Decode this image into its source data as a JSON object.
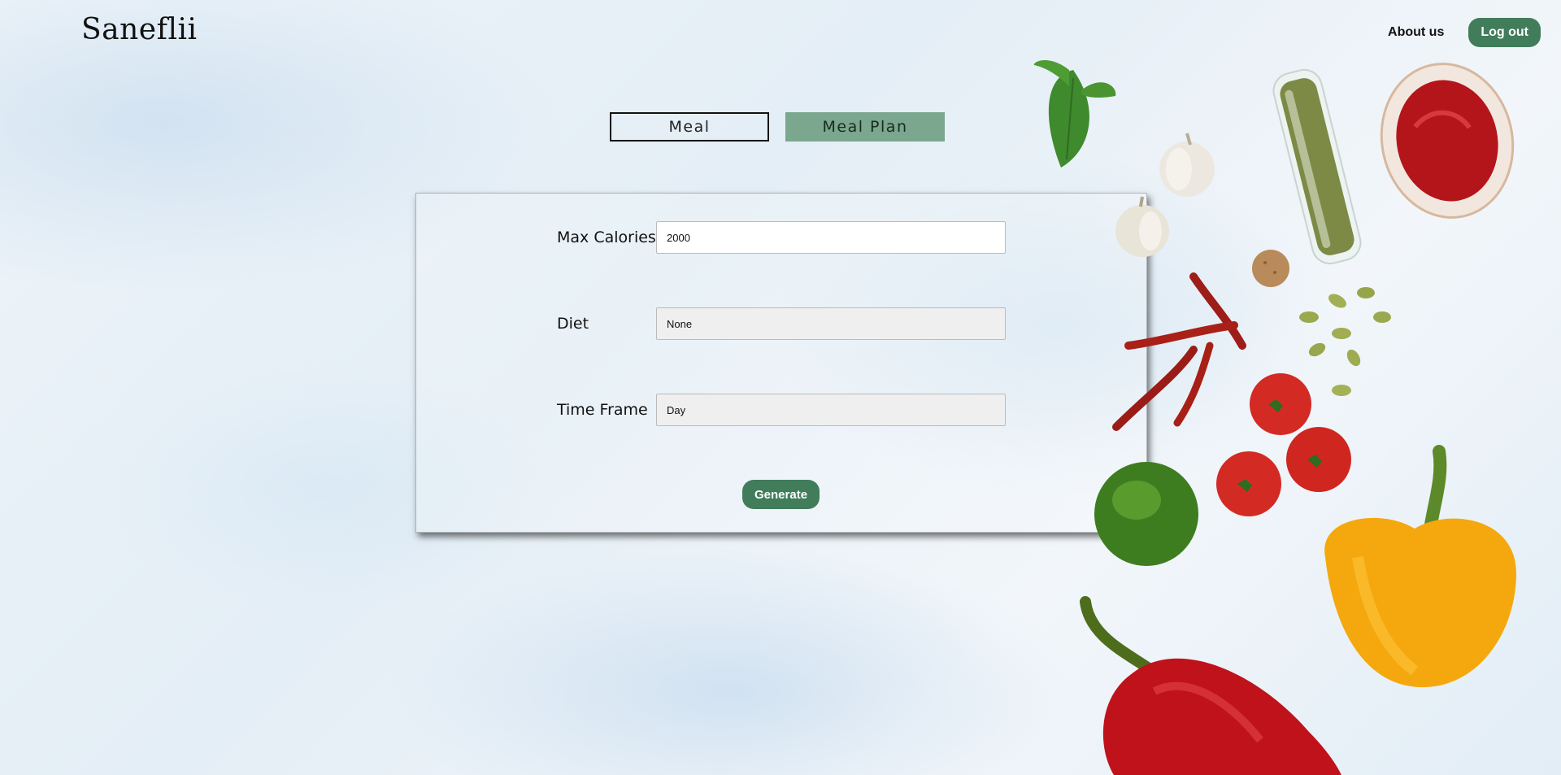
{
  "header": {
    "brand": "Saneflii",
    "about_label": "About us",
    "logout_label": "Log out"
  },
  "tabs": [
    {
      "label": "Meal",
      "active": false
    },
    {
      "label": "Meal Plan",
      "active": true
    }
  ],
  "form": {
    "max_calories_label": "Max Calories",
    "max_calories_value": "2000",
    "diet_label": "Diet",
    "diet_value": "None",
    "time_frame_label": "Time Frame",
    "time_frame_value": "Day",
    "generate_label": "Generate"
  },
  "colors": {
    "accent": "#417c5b",
    "active_tab": "#7aa78d"
  },
  "decor_icons": [
    "basil-icon",
    "garlic-icon",
    "pumpkin-seed-jar-icon",
    "ketchup-bowl-icon",
    "chili-pepper-icon",
    "tomato-icon",
    "lime-icon",
    "yellow-pepper-icon",
    "red-pepper-icon",
    "cracker-icon",
    "pumpkin-seeds-icon"
  ]
}
